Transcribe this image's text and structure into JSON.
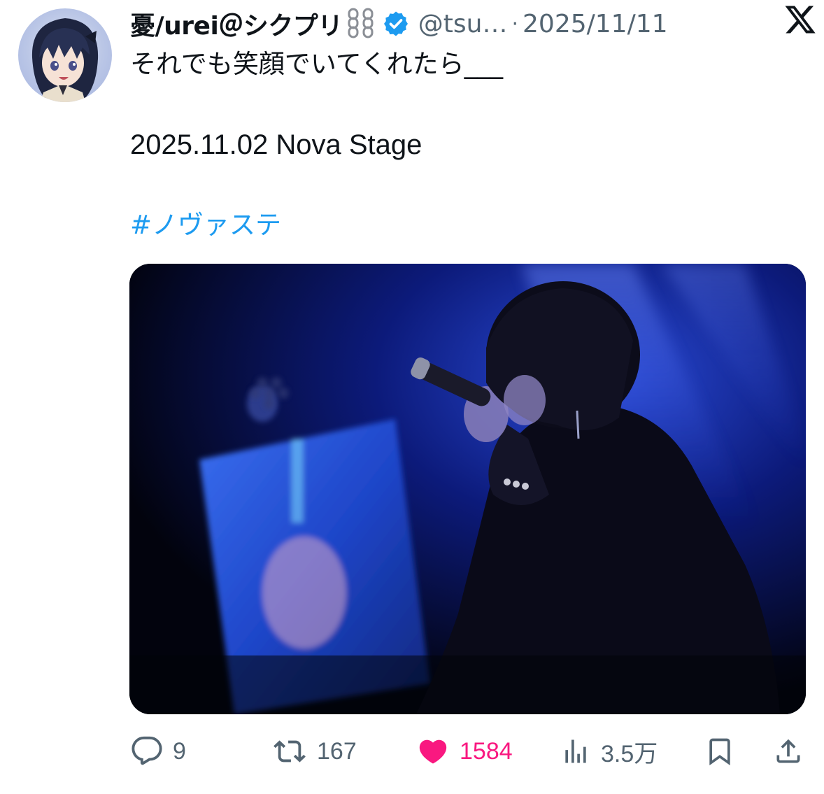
{
  "tweet": {
    "display_name": "憂/urei＠シクプリ",
    "name_emoji": "chain-icon",
    "verified_icon": "verified-badge-icon",
    "handle": "@tsu…",
    "separator": "·",
    "date": "2025/11/11",
    "brand_icon": "x-logo-icon",
    "text_line_1": "それでも笑顔でいてくれたら___",
    "text_line_2": "2025.11.02 Nova Stage",
    "hashtag": "#ノヴァステ",
    "media": "photo"
  },
  "actions": {
    "reply_count": "9",
    "retweet_count": "167",
    "like_count": "1584",
    "views_count": "3.5万",
    "icons": [
      "reply-icon",
      "retweet-icon",
      "like-icon",
      "views-icon",
      "bookmark-icon",
      "share-icon"
    ]
  },
  "colors": {
    "text": "#0f1419",
    "secondary": "#536471",
    "link": "#1d9bf0",
    "like": "#f91880",
    "verified": "#1d9bf0"
  }
}
